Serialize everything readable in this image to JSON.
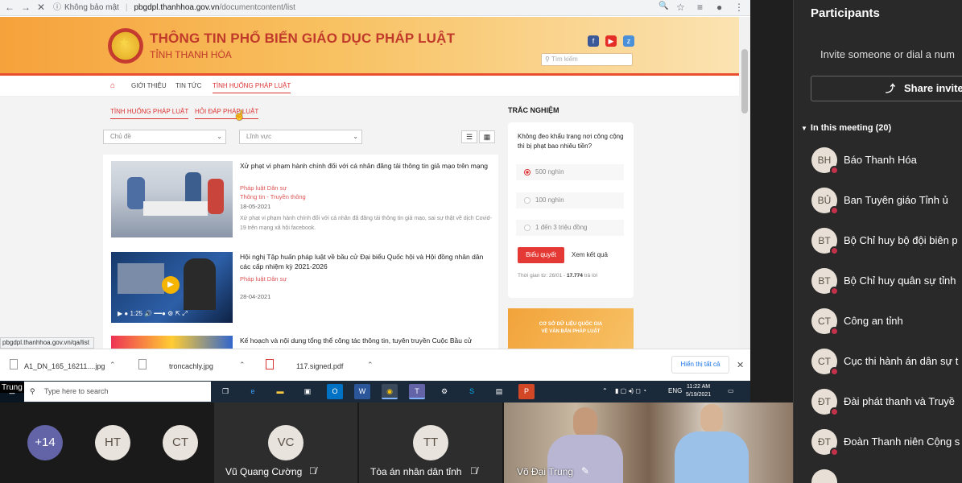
{
  "browser": {
    "security": "Không bảo mật",
    "url_host": "pbgdpl.thanhhoa.gov.vn",
    "url_path": "/documentcontent/list",
    "status_url": "pbgdpl.thanhhoa.gov.vn/qa/list"
  },
  "site": {
    "title": "THÔNG TIN PHỔ BIẾN GIÁO DỤC PHÁP LUẬT",
    "subtitle": "TỈNH THANH HÓA",
    "search_placeholder": "Tìm kiếm",
    "nav": [
      "GIỚI THIỆU",
      "TIN TỨC",
      "TÌNH HUỐNG PHÁP LUẬT"
    ],
    "subtabs": [
      "TÌNH HUỐNG PHÁP LUẬT",
      "HỎI ĐÁP PHÁP LUẬT"
    ],
    "filter_topic": "Chủ đề",
    "filter_field": "Lĩnh vực",
    "articles": [
      {
        "title": "Xử phạt vi phạm hành chính đối với cá nhân đăng tải thông tin giả mạo trên mạng",
        "category": "Pháp luật Dân sự",
        "category2": "Thông tin - Truyền thông",
        "date": "18-05-2021",
        "desc": "Xử phạt vi phạm hành chính đối với cá nhân đã đăng tải thông tin giả mạo, sai sự thật về dịch Covid-19 trên mạng xã hội facebook."
      },
      {
        "title": "Hội nghị Tập huấn pháp luật về bầu cử Đại biểu Quốc hội và Hội đồng nhân dân các cấp nhiệm kỳ 2021-2026",
        "category": "Pháp luật Dân sự",
        "date": "28-04-2021",
        "video_time": "1:25"
      },
      {
        "title": "Kế hoạch và nội dung tổng thể công tác thông tin, tuyên truyền Cuộc Bầu cử"
      }
    ],
    "quiz": {
      "heading": "TRẮC NGHIỆM",
      "question": "Không đeo khẩu trang nơi công cộng thì bị phạt bao nhiêu tiền?",
      "options": [
        "500 nghìn",
        "100 nghìn",
        "1 đến 3 triệu đồng"
      ],
      "vote": "Biểu quyết",
      "results": "Xem kết quả",
      "time_prefix": "Thời gian từ: 26/01 - ",
      "count": "17.774",
      "count_suffix": " trả lời"
    },
    "db_banner": [
      "CƠ SỞ DỮ LIỆU QUỐC GIA",
      "VỀ VĂN BẢN PHÁP LUẬT"
    ]
  },
  "downloads": {
    "files": [
      "A1_DN_165_16211....jpg",
      "troncachly.jpg",
      "117.signed.pdf"
    ],
    "show_all": "Hiển thị tất cả"
  },
  "taskbar": {
    "search": "Type here to search",
    "lang": "ENG",
    "time": "11:22 AM",
    "date": "5/19/2021"
  },
  "presenter_label": "Trung",
  "sidebar": {
    "title": "Participants",
    "invite": "Invite someone or dial a num",
    "share": "Share invite",
    "in_meeting": "In this meeting (20)",
    "participants": [
      {
        "initials": "BH",
        "name": "Báo Thanh Hóa"
      },
      {
        "initials": "BỦ",
        "name": "Ban Tuyên giáo Tỉnh ủ"
      },
      {
        "initials": "BT",
        "name": "Bộ Chỉ huy bộ đội biên p"
      },
      {
        "initials": "BT",
        "name": "Bộ Chỉ huy quân sự tỉnh"
      },
      {
        "initials": "CT",
        "name": "Công an tỉnh"
      },
      {
        "initials": "CT",
        "name": "Cục thi hành án dân sự t"
      },
      {
        "initials": "ĐT",
        "name": "Đài phát thanh và Truyề"
      },
      {
        "initials": "ĐT",
        "name": "Đoàn Thanh niên Cộng s"
      }
    ]
  },
  "video_strip": {
    "overflow": "+14",
    "tiles": [
      {
        "initials": "HT"
      },
      {
        "initials": "CT"
      },
      {
        "initials": "VC",
        "name": "Vũ Quang Cường"
      },
      {
        "initials": "TT",
        "name": "Tòa án nhân dân tỉnh"
      },
      {
        "name": "Võ Đại Trung"
      }
    ]
  },
  "colors": {
    "accent": "#d33",
    "teams": "#6264a7",
    "sidebar_bg": "#292929"
  }
}
